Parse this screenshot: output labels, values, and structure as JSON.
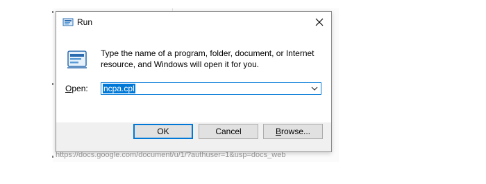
{
  "dialog": {
    "title": "Run",
    "instructions": "Type the name of a program, folder, document, or Internet resource, and Windows will open it for you.",
    "open_label_prefix": "O",
    "open_label_rest": "pen:",
    "command_value": "ncpa.cpl",
    "ok_label": "OK",
    "cancel_label": "Cancel",
    "browse_label_prefix": "B",
    "browse_label_rest": "rowse..."
  },
  "background": {
    "url_text": "https://docs.google.com/document/u/1/?authuser=1&usp=docs_web"
  },
  "colors": {
    "accent": "#0078d7",
    "footer": "#f0f0f0",
    "button": "#e1e1e1"
  },
  "icons": {
    "title": "run-icon",
    "close": "close-icon",
    "main": "run-icon",
    "dropdown": "chevron-down-icon"
  }
}
